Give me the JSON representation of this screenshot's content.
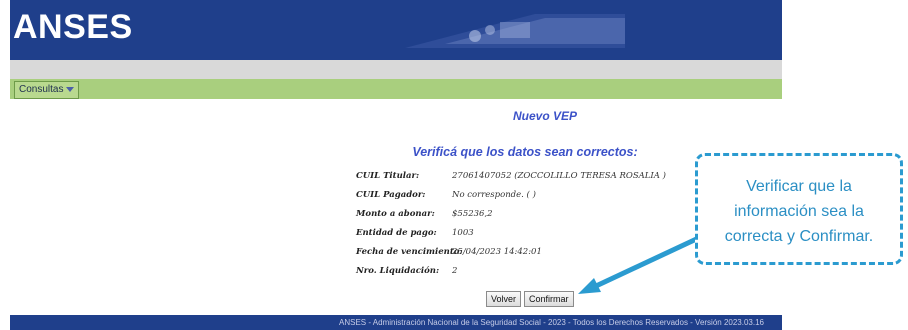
{
  "header": {
    "logo_text": "ANSES"
  },
  "menu": {
    "consultas_label": "Consultas"
  },
  "content": {
    "title": "Nuevo VEP",
    "subtitle": "Verificá que los datos sean correctos:",
    "fields": [
      {
        "label": "CUIL Titular:",
        "value": "27061407052  (ZOCCOLILLO TERESA ROSALIA )"
      },
      {
        "label": "CUIL Pagador:",
        "value": "No corresponde.  ( )"
      },
      {
        "label": "Monto a abonar:",
        "value": "$55236,2"
      },
      {
        "label": "Entidad de pago:",
        "value": "1003"
      },
      {
        "label": "Fecha de vencimiento:",
        "value": "25/04/2023 14:42:01"
      },
      {
        "label": "Nro. Liquidación:",
        "value": "2"
      }
    ],
    "buttons": {
      "back_label": "Volver",
      "confirm_label": "Confirmar"
    }
  },
  "footer": {
    "text": "ANSES - Administración Nacional de la Seguridad Social - 2023 - Todos los Derechos Reservados - Versión 2023.03.16"
  },
  "callout": {
    "line1": "Verificar que la",
    "line2": "información sea la",
    "line3": "correcta y Confirmar."
  },
  "colors": {
    "header_bg": "#1f3f8b",
    "menu_bg": "#a9cf7e",
    "title_blue": "#3c52c8",
    "callout_blue": "#2b9bd0"
  }
}
